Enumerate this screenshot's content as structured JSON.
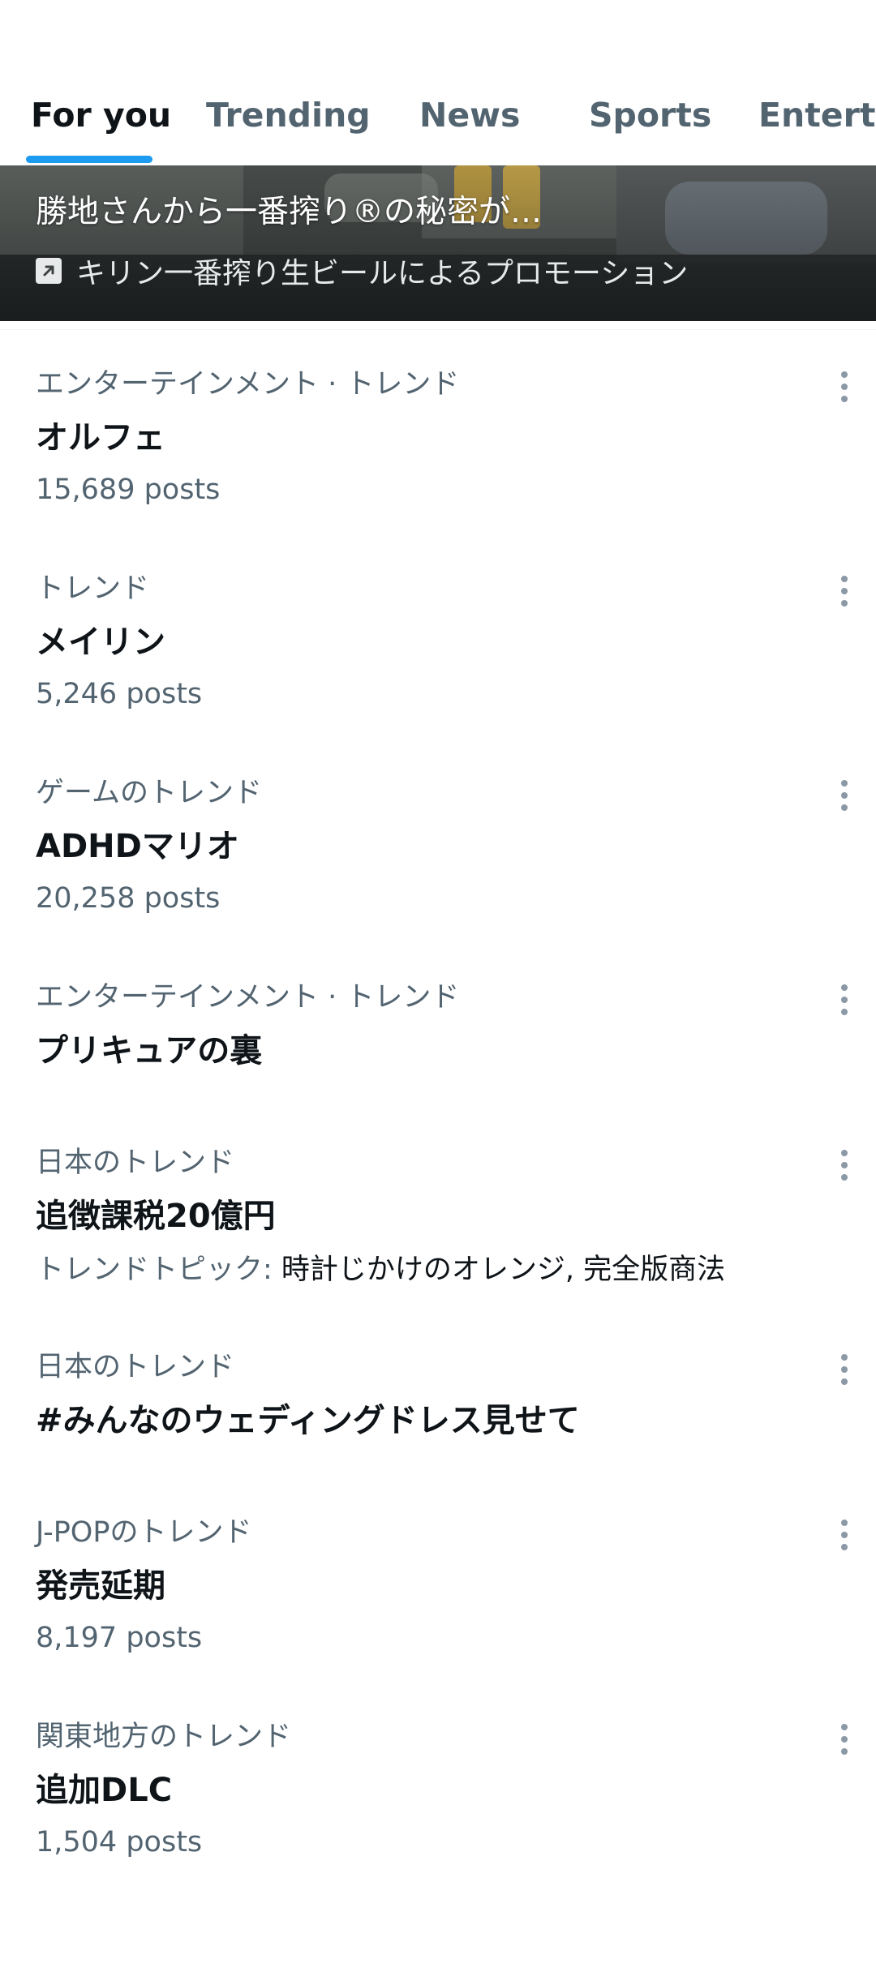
{
  "tabs": [
    {
      "label": "For you",
      "active": true
    },
    {
      "label": "Trending",
      "active": false
    },
    {
      "label": "News",
      "active": false
    },
    {
      "label": "Sports",
      "active": false
    },
    {
      "label": "Entertainment",
      "active": false
    }
  ],
  "promo": {
    "headline": "勝地さんから一番搾り®の秘密が…",
    "sponsor": "キリン一番搾り生ビールによるプロモーション",
    "icon": "promoted-arrow-icon"
  },
  "trends": [
    {
      "category": "エンターテインメント · トレンド",
      "name": "オルフェ",
      "posts": "15,689 posts"
    },
    {
      "category": "トレンド",
      "name": "メイリン",
      "posts": "5,246 posts"
    },
    {
      "category": "ゲームのトレンド",
      "name": "ADHDマリオ",
      "posts": "20,258 posts"
    },
    {
      "category": "エンターテインメント · トレンド",
      "name": "プリキュアの裏"
    },
    {
      "category": "日本のトレンド",
      "name": "追徴課税20億円",
      "topic_label": "トレンドトピック: ",
      "topic_value": "時計じかけのオレンジ, 完全版商法"
    },
    {
      "category": "日本のトレンド",
      "name": "#みんなのウェディングドレス見せて"
    },
    {
      "category": "J-POPのトレンド",
      "name": "発売延期",
      "posts": "8,197 posts"
    },
    {
      "category": "関東地方のトレンド",
      "name": "追加DLC",
      "posts": "1,504 posts"
    }
  ],
  "colors": {
    "accent": "#1d9bf0",
    "text_primary": "#0f1419",
    "text_secondary": "#536471"
  },
  "icons": {
    "more": "more-vertical-icon"
  }
}
